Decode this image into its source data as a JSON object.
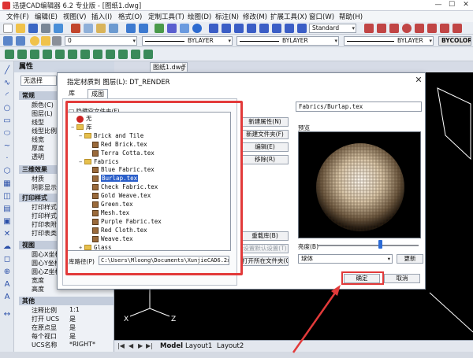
{
  "app": {
    "title": "迅捷CAD编辑器 6.2 专业版 - [图纸1.dwg]",
    "window_buttons": [
      "—",
      "☐",
      "✕"
    ]
  },
  "menus": [
    "文件(F)",
    "编辑(E)",
    "视图(V)",
    "插入(I)",
    "格式(O)",
    "定制工具(T)",
    "绘图(D)",
    "标注(N)",
    "修改(M)",
    "扩展工具(X)",
    "窗口(W)",
    "帮助(H)"
  ],
  "toolbar": {
    "text_style": "Standard",
    "layer_value": "0",
    "linetype1": "BYLAYER",
    "linetype2": "BYLAYER",
    "lineweight": "BYLAYER",
    "color_btn": "BYCOLOR"
  },
  "properties": {
    "header": "属性",
    "selection": "无选择",
    "sections": {
      "general": {
        "title": "常规",
        "rows": [
          "颜色(C)",
          "图层(L)",
          "线型",
          "线型比例",
          "线宽",
          "厚度",
          "透明"
        ]
      },
      "3d": {
        "title": "三维效果",
        "rows": [
          "材质",
          "阴影显示"
        ]
      },
      "print": {
        "title": "打印样式",
        "rows": [
          "打印样式",
          "打印样式",
          "打印表附",
          "打印表类"
        ]
      },
      "view": {
        "title": "视图",
        "rows": [
          "圆心X坐标",
          "圆心Y坐标",
          "圆心Z坐标",
          "宽度",
          "高度"
        ]
      },
      "other": {
        "title": "其他",
        "rows": [
          {
            "label": "注释比例",
            "value": "1:1"
          },
          {
            "label": "打开 UCS",
            "value": "是"
          },
          {
            "label": "在原点显",
            "value": "是"
          },
          {
            "label": "每个视口",
            "value": "是"
          },
          {
            "label": "UCS名称",
            "value": "*RIGHT*"
          }
        ]
      }
    }
  },
  "document": {
    "tab": "图纸1.dwg",
    "layout_tabs": [
      "Model",
      "Layout1",
      "Layout2"
    ]
  },
  "dialog": {
    "title": "指定材质到 图层(L): DT_RENDER",
    "tabs": [
      "库",
      "成图"
    ],
    "checkbox": "□ 隐藏空文件夹(F)",
    "tree": [
      {
        "label": "无",
        "type": "none",
        "depth": 0
      },
      {
        "label": "库",
        "type": "folder",
        "depth": 0,
        "expanded": true
      },
      {
        "label": "Brick and Tile",
        "type": "folder",
        "depth": 1,
        "expanded": true
      },
      {
        "label": "Red Brick.tex",
        "type": "tex",
        "depth": 2
      },
      {
        "label": "Terra Cotta.tex",
        "type": "tex",
        "depth": 2
      },
      {
        "label": "Fabrics",
        "type": "folder",
        "depth": 1,
        "expanded": true
      },
      {
        "label": "Blue Fabric.tex",
        "type": "tex",
        "depth": 2
      },
      {
        "label": "Burlap.tex",
        "type": "tex",
        "depth": 2,
        "selected": true
      },
      {
        "label": "Check Fabric.tex",
        "type": "tex",
        "depth": 2
      },
      {
        "label": "Gold Weave.tex",
        "type": "tex",
        "depth": 2
      },
      {
        "label": "Green.tex",
        "type": "tex",
        "depth": 2
      },
      {
        "label": "Mesh.tex",
        "type": "tex",
        "depth": 2
      },
      {
        "label": "Purple Fabric.tex",
        "type": "tex",
        "depth": 2
      },
      {
        "label": "Red Cloth.tex",
        "type": "tex",
        "depth": 2
      },
      {
        "label": "Weave.tex",
        "type": "tex",
        "depth": 2
      },
      {
        "label": "Glass",
        "type": "folder",
        "depth": 1,
        "expanded": false
      }
    ],
    "path_label": "库路径(P)",
    "path_value": "C:\\Users\\Mloong\\Documents\\XunjieCAD6.2x86\\Tex",
    "buttons": {
      "new_property": "新建属性(N)",
      "new_folder": "新建文件夹(F)",
      "edit": "编辑(E)",
      "remove": "移除(R)",
      "reload": "重载库(B)",
      "set_default": "设置默认设置(T)",
      "open_folder": "打开所在文件夹(O)",
      "ok": "确定",
      "cancel": "取消",
      "update": "更新"
    },
    "material_name": "Fabrics/Burlap.tex",
    "preview_label": "预览",
    "brightness_label": "亮度(B)",
    "brightness_level": 0.62,
    "shape": "球体"
  },
  "colors": {
    "accent": "#2a5ec9",
    "annotation": "#e23a3a",
    "canvas": "#000000"
  }
}
